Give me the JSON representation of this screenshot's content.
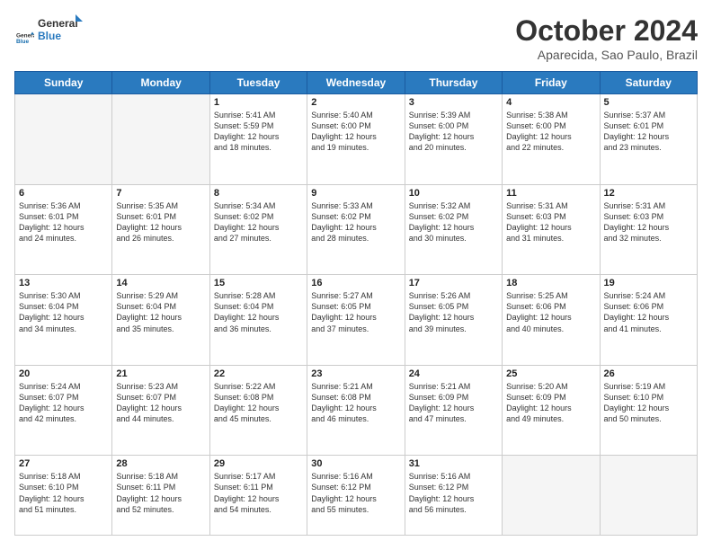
{
  "logo": {
    "line1": "General",
    "line2": "Blue"
  },
  "title": "October 2024",
  "location": "Aparecida, Sao Paulo, Brazil",
  "days_header": [
    "Sunday",
    "Monday",
    "Tuesday",
    "Wednesday",
    "Thursday",
    "Friday",
    "Saturday"
  ],
  "weeks": [
    [
      {
        "day": "",
        "info": ""
      },
      {
        "day": "",
        "info": ""
      },
      {
        "day": "1",
        "info": "Sunrise: 5:41 AM\nSunset: 5:59 PM\nDaylight: 12 hours\nand 18 minutes."
      },
      {
        "day": "2",
        "info": "Sunrise: 5:40 AM\nSunset: 6:00 PM\nDaylight: 12 hours\nand 19 minutes."
      },
      {
        "day": "3",
        "info": "Sunrise: 5:39 AM\nSunset: 6:00 PM\nDaylight: 12 hours\nand 20 minutes."
      },
      {
        "day": "4",
        "info": "Sunrise: 5:38 AM\nSunset: 6:00 PM\nDaylight: 12 hours\nand 22 minutes."
      },
      {
        "day": "5",
        "info": "Sunrise: 5:37 AM\nSunset: 6:01 PM\nDaylight: 12 hours\nand 23 minutes."
      }
    ],
    [
      {
        "day": "6",
        "info": "Sunrise: 5:36 AM\nSunset: 6:01 PM\nDaylight: 12 hours\nand 24 minutes."
      },
      {
        "day": "7",
        "info": "Sunrise: 5:35 AM\nSunset: 6:01 PM\nDaylight: 12 hours\nand 26 minutes."
      },
      {
        "day": "8",
        "info": "Sunrise: 5:34 AM\nSunset: 6:02 PM\nDaylight: 12 hours\nand 27 minutes."
      },
      {
        "day": "9",
        "info": "Sunrise: 5:33 AM\nSunset: 6:02 PM\nDaylight: 12 hours\nand 28 minutes."
      },
      {
        "day": "10",
        "info": "Sunrise: 5:32 AM\nSunset: 6:02 PM\nDaylight: 12 hours\nand 30 minutes."
      },
      {
        "day": "11",
        "info": "Sunrise: 5:31 AM\nSunset: 6:03 PM\nDaylight: 12 hours\nand 31 minutes."
      },
      {
        "day": "12",
        "info": "Sunrise: 5:31 AM\nSunset: 6:03 PM\nDaylight: 12 hours\nand 32 minutes."
      }
    ],
    [
      {
        "day": "13",
        "info": "Sunrise: 5:30 AM\nSunset: 6:04 PM\nDaylight: 12 hours\nand 34 minutes."
      },
      {
        "day": "14",
        "info": "Sunrise: 5:29 AM\nSunset: 6:04 PM\nDaylight: 12 hours\nand 35 minutes."
      },
      {
        "day": "15",
        "info": "Sunrise: 5:28 AM\nSunset: 6:04 PM\nDaylight: 12 hours\nand 36 minutes."
      },
      {
        "day": "16",
        "info": "Sunrise: 5:27 AM\nSunset: 6:05 PM\nDaylight: 12 hours\nand 37 minutes."
      },
      {
        "day": "17",
        "info": "Sunrise: 5:26 AM\nSunset: 6:05 PM\nDaylight: 12 hours\nand 39 minutes."
      },
      {
        "day": "18",
        "info": "Sunrise: 5:25 AM\nSunset: 6:06 PM\nDaylight: 12 hours\nand 40 minutes."
      },
      {
        "day": "19",
        "info": "Sunrise: 5:24 AM\nSunset: 6:06 PM\nDaylight: 12 hours\nand 41 minutes."
      }
    ],
    [
      {
        "day": "20",
        "info": "Sunrise: 5:24 AM\nSunset: 6:07 PM\nDaylight: 12 hours\nand 42 minutes."
      },
      {
        "day": "21",
        "info": "Sunrise: 5:23 AM\nSunset: 6:07 PM\nDaylight: 12 hours\nand 44 minutes."
      },
      {
        "day": "22",
        "info": "Sunrise: 5:22 AM\nSunset: 6:08 PM\nDaylight: 12 hours\nand 45 minutes."
      },
      {
        "day": "23",
        "info": "Sunrise: 5:21 AM\nSunset: 6:08 PM\nDaylight: 12 hours\nand 46 minutes."
      },
      {
        "day": "24",
        "info": "Sunrise: 5:21 AM\nSunset: 6:09 PM\nDaylight: 12 hours\nand 47 minutes."
      },
      {
        "day": "25",
        "info": "Sunrise: 5:20 AM\nSunset: 6:09 PM\nDaylight: 12 hours\nand 49 minutes."
      },
      {
        "day": "26",
        "info": "Sunrise: 5:19 AM\nSunset: 6:10 PM\nDaylight: 12 hours\nand 50 minutes."
      }
    ],
    [
      {
        "day": "27",
        "info": "Sunrise: 5:18 AM\nSunset: 6:10 PM\nDaylight: 12 hours\nand 51 minutes."
      },
      {
        "day": "28",
        "info": "Sunrise: 5:18 AM\nSunset: 6:11 PM\nDaylight: 12 hours\nand 52 minutes."
      },
      {
        "day": "29",
        "info": "Sunrise: 5:17 AM\nSunset: 6:11 PM\nDaylight: 12 hours\nand 54 minutes."
      },
      {
        "day": "30",
        "info": "Sunrise: 5:16 AM\nSunset: 6:12 PM\nDaylight: 12 hours\nand 55 minutes."
      },
      {
        "day": "31",
        "info": "Sunrise: 5:16 AM\nSunset: 6:12 PM\nDaylight: 12 hours\nand 56 minutes."
      },
      {
        "day": "",
        "info": ""
      },
      {
        "day": "",
        "info": ""
      }
    ]
  ]
}
